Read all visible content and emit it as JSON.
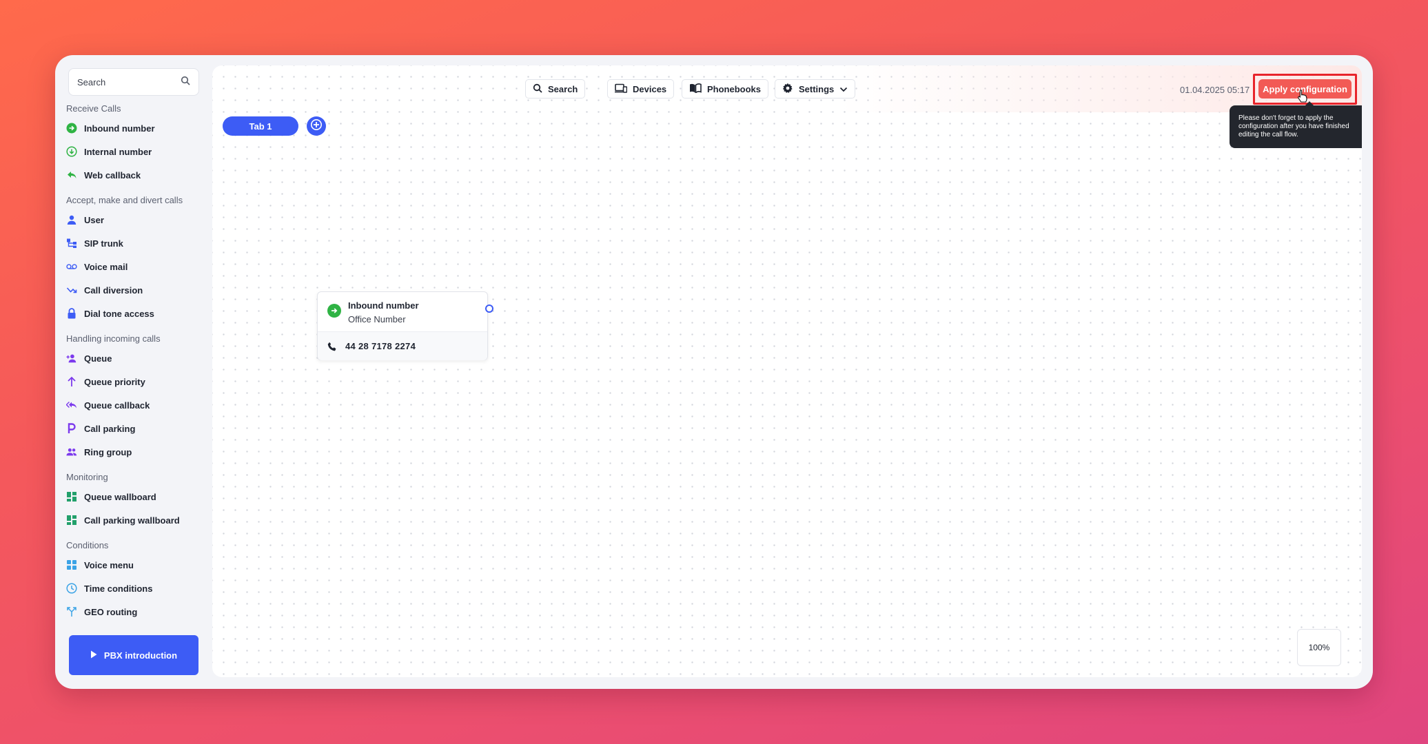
{
  "sidebar": {
    "search_placeholder": "Search",
    "sections": {
      "receive_calls": "Receive Calls",
      "accept": "Accept, make and divert calls",
      "handling": "Handling incoming calls",
      "monitoring": "Monitoring",
      "conditions": "Conditions"
    },
    "items": {
      "inbound_number": "Inbound number",
      "internal_number": "Internal number",
      "web_callback": "Web callback",
      "user": "User",
      "sip_trunk": "SIP trunk",
      "voice_mail": "Voice mail",
      "call_diversion": "Call diversion",
      "dial_tone_access": "Dial tone access",
      "queue": "Queue",
      "queue_priority": "Queue priority",
      "queue_callback": "Queue callback",
      "call_parking": "Call parking",
      "ring_group": "Ring group",
      "queue_wallboard": "Queue wallboard",
      "call_parking_wallboard": "Call parking wallboard",
      "voice_menu": "Voice menu",
      "time_conditions": "Time conditions",
      "geo_routing": "GEO routing"
    },
    "pbx_intro_label": "PBX introduction"
  },
  "toolbar": {
    "search_label": "Search",
    "devices_label": "Devices",
    "phonebooks_label": "Phonebooks",
    "settings_label": "Settings",
    "datetime": "01.04.2025 05:17",
    "apply_label": "Apply configuration",
    "tooltip_text": "Please don't forget to apply the configuration after you have finished editing the call flow."
  },
  "tabs": [
    {
      "label": "Tab 1"
    }
  ],
  "node": {
    "title": "Inbound number",
    "subtitle": "Office Number",
    "number": "44 28 7178 2274"
  },
  "zoom_level": "100%",
  "colors": {
    "accent_blue": "#3d5cf5",
    "apply_red": "#f25a55",
    "highlight_red": "#e8242b",
    "green": "#2fb344",
    "purple": "#7c3aed",
    "teal": "#22a06b",
    "sky": "#3ba3e6"
  }
}
